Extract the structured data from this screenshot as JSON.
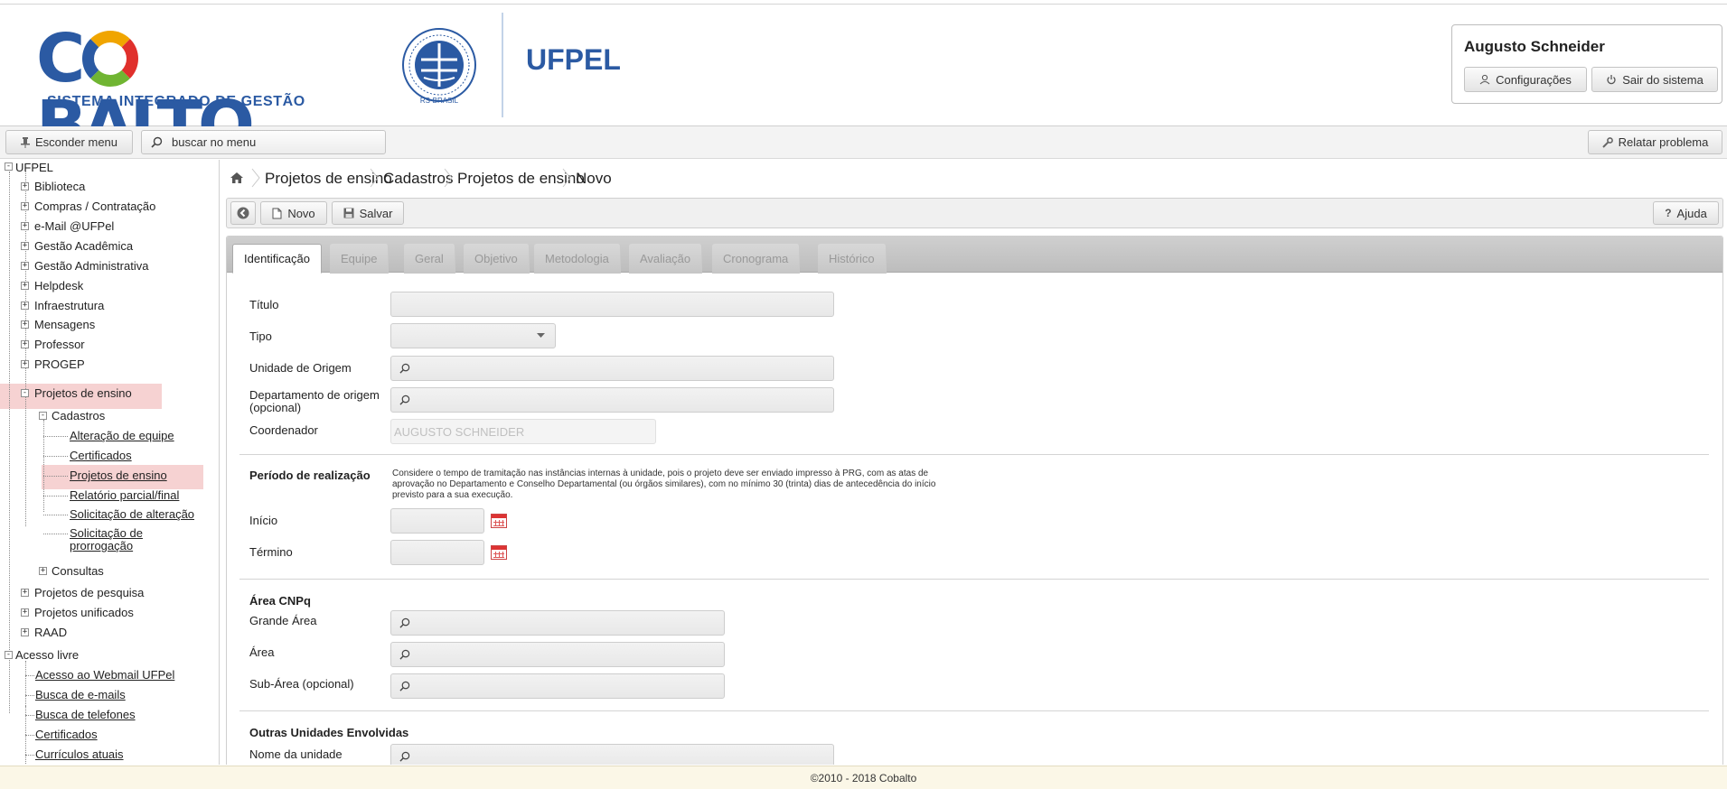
{
  "brand": {
    "name": "COBALTO",
    "subtitle": "SISTEMA INTEGRADO DE GESTÃO",
    "institution": "UFPEL"
  },
  "user": {
    "name": "Augusto Schneider",
    "settings_label": "Configurações",
    "logout_label": "Sair do sistema"
  },
  "toolbar": {
    "hide_menu_label": "Esconder menu",
    "search_placeholder": "buscar no menu",
    "report_problem_label": "Relatar problema"
  },
  "sidebar": {
    "root": "UFPEL",
    "items": [
      "Biblioteca",
      "Compras / Contratação",
      "e-Mail @UFPel",
      "Gestão Acadêmica",
      "Gestão Administrativa",
      "Helpdesk",
      "Infraestrutura",
      "Mensagens",
      "Professor",
      "PROGEP"
    ],
    "projetos_ensino": "Projetos de ensino",
    "cadastros": "Cadastros",
    "cadastros_items": [
      "Alteração de equipe",
      "Certificados",
      "Projetos de ensino",
      "Relatório parcial/final",
      "Solicitação de alteração",
      "Solicitação de",
      "prorrogação"
    ],
    "consultas": "Consultas",
    "after_items": [
      "Projetos de pesquisa",
      "Projetos unificados",
      "RAAD"
    ],
    "acesso_livre": "Acesso livre",
    "acesso_items": [
      "Acesso ao Webmail UFPel",
      "Busca de e-mails",
      "Busca de telefones",
      "Certificados",
      "Currículos atuais"
    ]
  },
  "breadcrumb": [
    "Projetos de ensino",
    "Cadastros",
    "Projetos de ensino",
    "Novo"
  ],
  "actions": {
    "new_label": "Novo",
    "save_label": "Salvar",
    "help_label": "Ajuda"
  },
  "tabs": [
    "Identificação",
    "Equipe",
    "Geral",
    "Objetivo",
    "Metodologia",
    "Avaliação",
    "Cronograma",
    "Histórico"
  ],
  "form": {
    "titulo_label": "Título",
    "tipo_label": "Tipo",
    "unidade_label": "Unidade de Origem",
    "departamento_label_1": "Departamento de origem",
    "departamento_label_2": "(opcional)",
    "coordenador_label": "Coordenador",
    "coordenador_value": "AUGUSTO SCHNEIDER",
    "periodo_title": "Período de realização",
    "periodo_note_1": "Considere o tempo de tramitação nas instâncias internas à unidade, pois o projeto deve ser enviado impresso à PRG, com as atas de",
    "periodo_note_2": "aprovação no Departamento e Conselho Departamental (ou órgãos similares), com no mínimo 30 (trinta) dias de antecedência do início",
    "periodo_note_3": "previsto para a sua execução.",
    "inicio_label": "Início",
    "termino_label": "Término",
    "area_cnpq_title": "Área CNPq",
    "grande_area_label": "Grande Área",
    "area_label": "Área",
    "sub_area_label": "Sub-Área (opcional)",
    "outras_title": "Outras Unidades Envolvidas",
    "nome_unidade_label": "Nome da unidade"
  },
  "footer": "©2010 - 2018 Cobalto",
  "colors": {
    "brand_blue": "#2b5aa3",
    "highlight": "#f6d2d2",
    "footer_bg": "#fbf7e7"
  }
}
